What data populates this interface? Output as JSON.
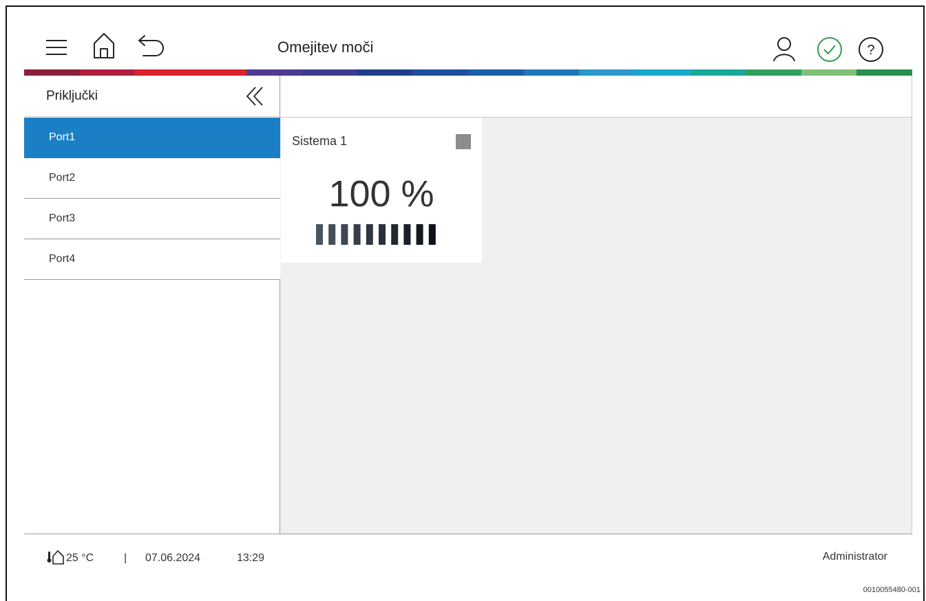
{
  "header": {
    "title": "Omejitev moči",
    "icons": [
      "menu-icon",
      "home-icon",
      "back-icon",
      "user-icon",
      "check-circle-icon",
      "help-icon"
    ],
    "status_color": "#2a9d4a"
  },
  "color_strip": [
    "#8c1f3d",
    "#b01f3f",
    "#d9222a",
    "#d9222a",
    "#4c3b8f",
    "#3d3b8e",
    "#1f3d8c",
    "#1f4f9c",
    "#1a5fa8",
    "#1f77b8",
    "#2a98c8",
    "#18a8cc",
    "#17a89c",
    "#2fa060",
    "#82c07a",
    "#2a9050"
  ],
  "sidebar": {
    "title": "Priključki",
    "items": [
      {
        "label": "Port1",
        "active": true
      },
      {
        "label": "Port2",
        "active": false
      },
      {
        "label": "Port3",
        "active": false
      },
      {
        "label": "Port4",
        "active": false
      }
    ],
    "active_color": "#1a7fc4"
  },
  "card": {
    "title": "Sistema 1",
    "value": "100 %",
    "level": 1.0,
    "bar_count": 10,
    "status_color": "#8a8d90"
  },
  "footer": {
    "temperature": "25 °C",
    "separator": "|",
    "date": "07.06.2024",
    "time": "13:29",
    "user": "Administrator"
  },
  "doc_id": "0010055480-001"
}
